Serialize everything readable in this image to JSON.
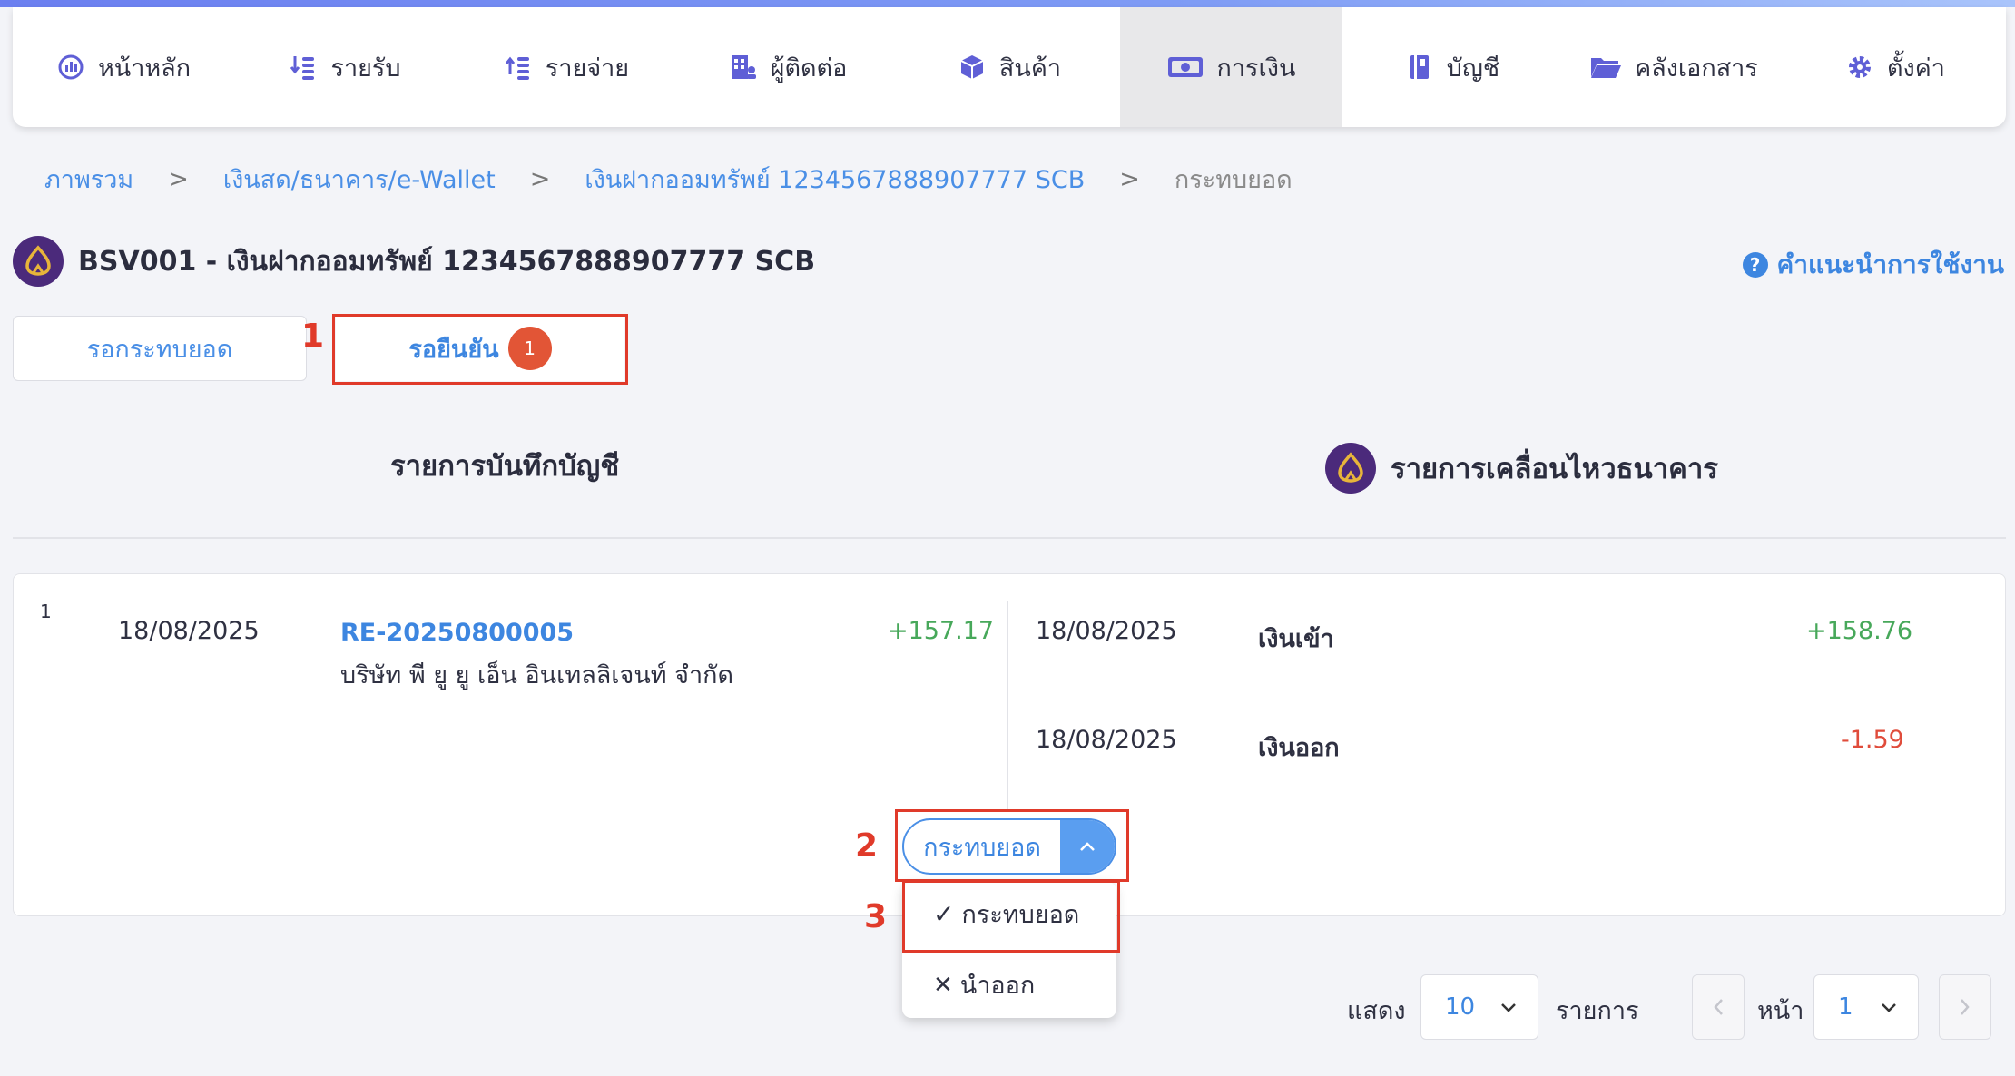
{
  "nav": {
    "items": [
      {
        "label": "หน้าหลัก",
        "icon": "dashboard-icon"
      },
      {
        "label": "รายรับ",
        "icon": "income-icon"
      },
      {
        "label": "รายจ่าย",
        "icon": "expense-icon"
      },
      {
        "label": "ผู้ติดต่อ",
        "icon": "contacts-icon"
      },
      {
        "label": "สินค้า",
        "icon": "box-icon"
      },
      {
        "label": "การเงิน",
        "icon": "money-icon"
      },
      {
        "label": "บัญชี",
        "icon": "ledger-icon"
      },
      {
        "label": "คลังเอกสาร",
        "icon": "folder-icon"
      },
      {
        "label": "ตั้งค่า",
        "icon": "gear-icon"
      }
    ],
    "active": "การเงิน"
  },
  "breadcrumb": {
    "items": [
      "ภาพรวม",
      "เงินสด/ธนาคาร/e-Wallet",
      "เงินฝากออมทรัพย์ 1234567888907777 SCB"
    ],
    "separator": ">",
    "current": "กระทบยอด"
  },
  "account": {
    "title": "BSV001 - เงินฝากออมทรัพย์ 1234567888907777 SCB"
  },
  "help": {
    "label": "คำแนะนำการใช้งาน",
    "icon_text": "?"
  },
  "tabs": {
    "pending": "รอกระทบยอด",
    "awaiting_confirm": "รอยืนยัน",
    "awaiting_badge": "1"
  },
  "annotations": [
    "1",
    "2",
    "3"
  ],
  "columns": {
    "ledger": "รายการบันทึกบัญชี",
    "bank": "รายการเคลื่อนไหวธนาคาร"
  },
  "row": {
    "index": "1",
    "ledger": {
      "date": "18/08/2025",
      "doc_no": "RE-20250800005",
      "party": "บริษัท พี ยู ยู เอ็น อินเทลลิเจนท์ จำกัด",
      "amount": "+157.17"
    },
    "bank": [
      {
        "date": "18/08/2025",
        "type": "เงินเข้า",
        "amount": "+158.76"
      },
      {
        "date": "18/08/2025",
        "type": "เงินออก",
        "amount": "-1.59"
      }
    ]
  },
  "action": {
    "button": "กระทบยอด",
    "menu": [
      {
        "label": "กระทบยอด",
        "glyph": "✓"
      },
      {
        "label": "นำออก",
        "glyph": "✕"
      }
    ]
  },
  "pagination": {
    "show_label": "แสดง",
    "page_size": "10",
    "items_label": "รายการ",
    "page_label": "หน้า",
    "page": "1"
  },
  "colors": {
    "accent": "#3d86e0",
    "positive": "#47a85a",
    "negative": "#e04c3b",
    "annotation": "#e03a2a",
    "bank_logo": "#4b2a7b"
  }
}
